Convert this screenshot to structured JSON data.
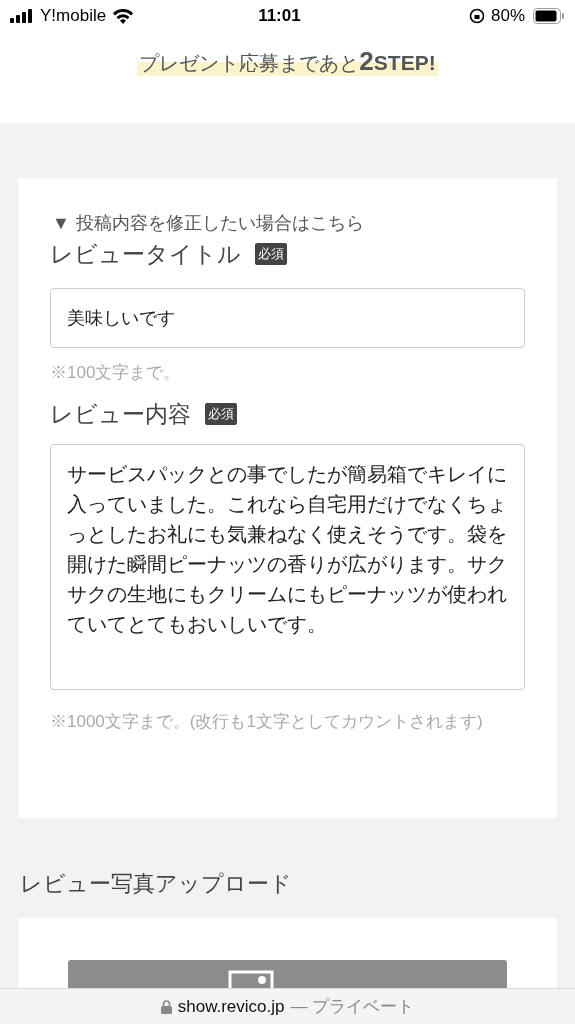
{
  "status_bar": {
    "carrier": "Y!mobile",
    "time": "11:01",
    "battery": "80%"
  },
  "banner": {
    "text": "プレゼント応募まであと",
    "step_number": "2",
    "step_label": "STEP!"
  },
  "edit_toggle": {
    "icon": "▼",
    "label": "投稿内容を修正したい場合はこちら",
    "expanded": true
  },
  "fields": [
    {
      "kind": "input",
      "label": "レビュータイトル",
      "required_badge": "必須",
      "value": "美味しいです",
      "note": "※100文字まで。"
    },
    {
      "kind": "textarea",
      "label": "レビュー内容",
      "required_badge": "必須",
      "value": "サービスパックとの事でしたが簡易箱でキレイに入っていました。これなら自宅用だけでなくちょっとしたお礼にも気兼ねなく使えそうです。袋を開けた瞬間ピーナッツの香りが広がります。サクサクの生地にもクリームにもピーナッツが使われていてとてもおいしいです。",
      "note": "※1000文字まで。(改行も1文字としてカウントされます)"
    }
  ],
  "photo_upload": {
    "heading": "レビュー写真アップロード"
  },
  "url_bar": {
    "domain": "show.revico.jp",
    "suffix": "— プライベート"
  }
}
